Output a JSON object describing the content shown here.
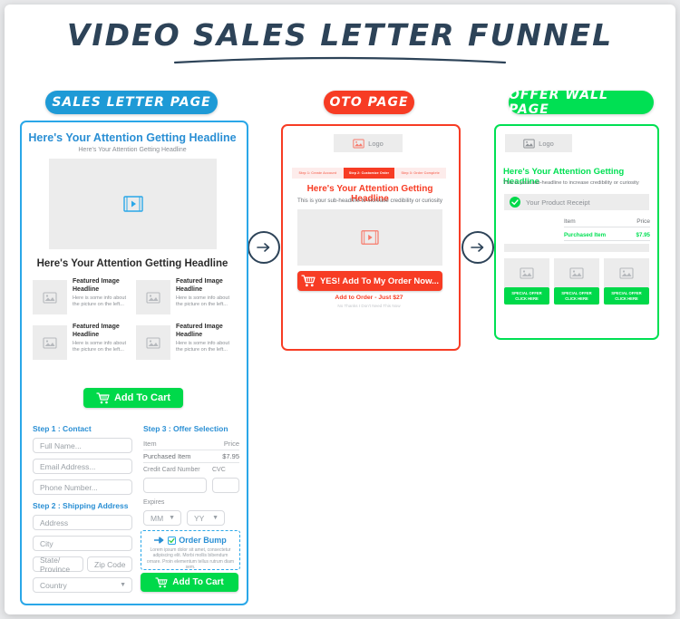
{
  "header": {
    "title": "VIDEO SALES LETTER FUNNEL"
  },
  "badges": {
    "sales": "SALES LETTER PAGE",
    "oto": "OTO PAGE",
    "wall": "OFFER WALL PAGE"
  },
  "colors": {
    "blue": "#2aa7e8",
    "red": "#f73c24",
    "green": "#00e053",
    "green_button": "#00d94a",
    "navy": "#2d4358",
    "grey_placeholder": "#ececec"
  },
  "arrows": {
    "arrow1": "arrow-right-icon",
    "arrow2": "arrow-right-icon"
  },
  "sales_page": {
    "headline": "Here's Your Attention Getting Headline",
    "sub_headline": "Here's Your Attention Getting Headline",
    "video_icon": "video-player-icon",
    "section_headline": "Here's Your Attention Getting Headline",
    "features": [
      {
        "title": "Featured Image Headline",
        "desc": "Here is some info about the picture on the left..."
      },
      {
        "title": "Featured Image Headline",
        "desc": "Here is some info about the picture on the left..."
      },
      {
        "title": "Featured Image Headline",
        "desc": "Here is some info about the picture on the left..."
      },
      {
        "title": "Featured Image Headline",
        "desc": "Here is some info about the picture on the left..."
      }
    ],
    "add_to_cart_top": "Add To Cart",
    "add_to_cart_bottom": "Add To Cart",
    "step1_title": "Step 1 : Contact",
    "step1_fields": [
      {
        "placeholder": "Full Name...",
        "value": ""
      },
      {
        "placeholder": "Email Address...",
        "value": ""
      },
      {
        "placeholder": "Phone Number...",
        "value": ""
      }
    ],
    "step2_title": "Step 2 : Shipping Address",
    "step2_fields": [
      {
        "placeholder": "Address",
        "value": ""
      },
      {
        "placeholder": "City",
        "value": ""
      },
      {
        "placeholder": "State/ Province",
        "value": ""
      },
      {
        "placeholder": "Zip Code",
        "value": ""
      },
      {
        "placeholder": "Country",
        "value": ""
      }
    ],
    "step3_title": "Step 3 : Offer Selection",
    "offer_table": {
      "columns": [
        "Item",
        "Price"
      ],
      "rows": [
        [
          "Purchased Item",
          "$7.95"
        ]
      ]
    },
    "cc_label": "Credit Card Number",
    "cvc_label": "CVC",
    "expires_label": "Expires",
    "expires_mm": "MM",
    "expires_yy": "YY",
    "order_bump": {
      "arrow_icon": "arrow-right-icon",
      "checkbox_icon": "checkbox-checked-icon",
      "title": "Order Bump",
      "text": "Lorem ipsum dolor sit amet, consectetur adipiscing elit. Morbi mollis bibendum ornare. Proin elementum tellus rutrum diam sem."
    }
  },
  "oto_page": {
    "logo_label": "Logo",
    "logo_icon": "image-placeholder-icon",
    "steps": [
      {
        "label": "Step 1: Create Account",
        "active": false
      },
      {
        "label": "Step 2: Customize Order",
        "active": true
      },
      {
        "label": "Step 3: Order Complete",
        "active": false
      }
    ],
    "headline": "Here's Your Attention Getting Headline",
    "sub_headline": "This is your sub-headline to increase credibility or curiosity",
    "video_icon": "video-player-icon",
    "cta_button": "YES! Add To My Order Now...",
    "cta_icon": "shopping-cart-icon",
    "price_note": "Add to Order - Just $27",
    "decline_note": "No Thanks I Don't Need This Now"
  },
  "offer_wall_page": {
    "logo_label": "Logo",
    "logo_icon": "image-placeholder-icon",
    "headline": "Here's Your Attention Getting Headline",
    "sub_headline": "This is your sub-headline to increase credibility or curiosity",
    "receipt_label": "Your Product Receipt",
    "receipt_icon": "check-circle-icon",
    "table": {
      "columns": [
        "Item",
        "Price"
      ],
      "rows": [
        [
          "Purchased Item",
          "$7.95"
        ]
      ]
    },
    "offers": [
      {
        "line1": "SPECIAL OFFER",
        "line2": "CLICK HERE"
      },
      {
        "line1": "SPECIAL OFFER",
        "line2": "CLICK HERE"
      },
      {
        "line1": "SPECIAL OFFER",
        "line2": "CLICK HERE"
      }
    ]
  }
}
